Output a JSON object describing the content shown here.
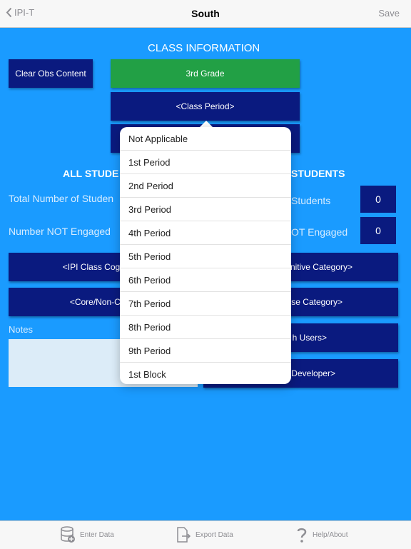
{
  "navbar": {
    "back_label": "IPI-T",
    "title": "South",
    "save_label": "Save"
  },
  "section_title": "CLASS INFORMATION",
  "clear_button": "Clear Obs Content",
  "grade_button": "3rd Grade",
  "class_period_button": "<Class Period>",
  "all_students_title": "ALL STUDE",
  "right_students_title": "STUDENTS",
  "labels": {
    "total_left": "Total Number of Studen",
    "total_right": "Students",
    "not_engaged_left": "Number NOT Engaged",
    "not_engaged_right": "OT Engaged"
  },
  "counts": {
    "total": "0",
    "not_engaged": "0"
  },
  "left_buttons": {
    "cognitive": "<IPI Class Cognitive",
    "core": "<Core/Non-Core"
  },
  "right_buttons": {
    "cognitive": "nitive Category>",
    "course": "se Category>",
    "users": "h Users>",
    "developer": "Developer>"
  },
  "notes_label": "Notes",
  "dropdown": {
    "options": [
      "Not Applicable",
      "1st Period",
      "2nd Period",
      "3rd Period",
      "4th Period",
      "5th Period",
      "6th Period",
      "7th Period",
      "8th Period",
      "9th Period",
      "1st Block"
    ]
  },
  "tabbar": {
    "enter_data": "Enter Data",
    "export_data": "Export Data",
    "help": "Help/About"
  },
  "colors": {
    "background": "#1a9bff",
    "button": "#0a1a7f",
    "grade": "#22a045"
  }
}
